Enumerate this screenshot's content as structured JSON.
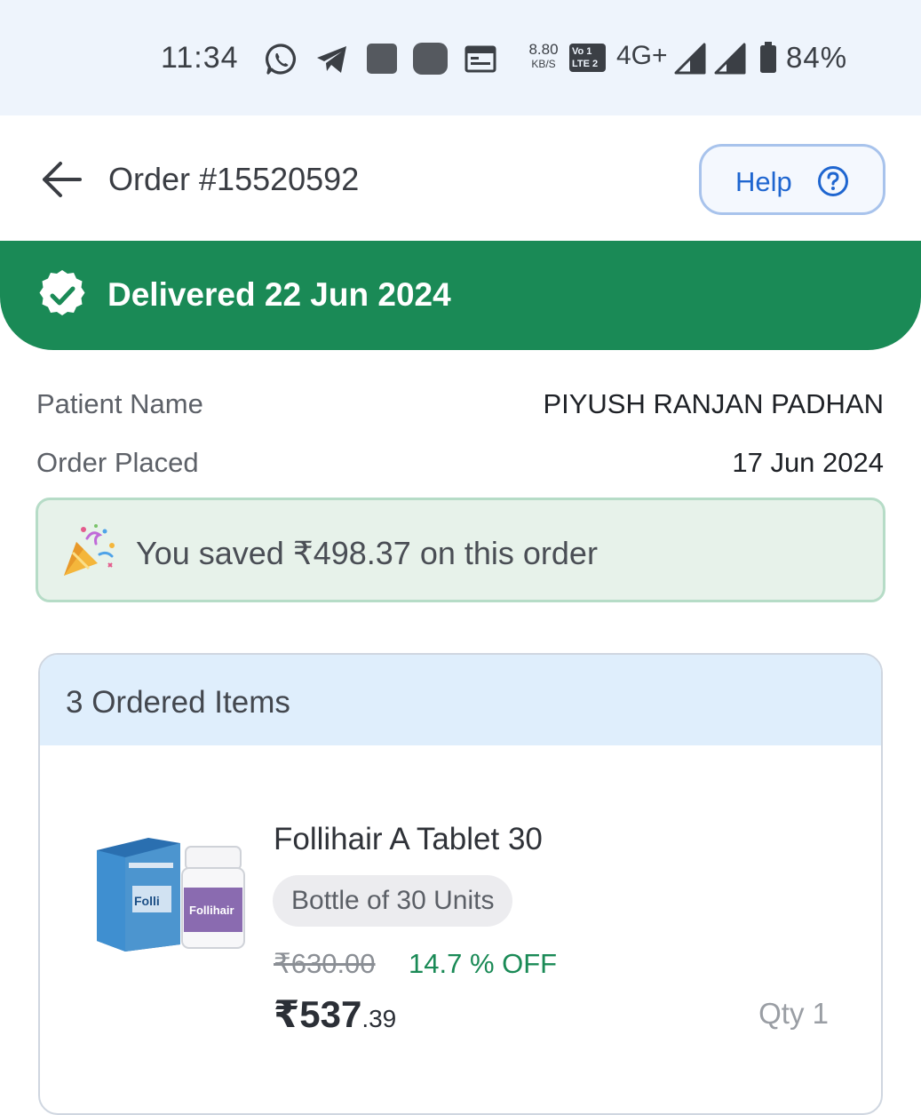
{
  "status_bar": {
    "time": "11:34",
    "net_speed_value": "8.80",
    "net_speed_unit": "KB/S",
    "volte_top": "Vo 1",
    "volte_bottom": "LTE 2",
    "network": "4G+",
    "battery": "84%",
    "icons": [
      "whatsapp-icon",
      "telegram-icon",
      "app-square-icon",
      "app-rounded-icon",
      "calendar-icon",
      "signal-sim1-icon",
      "signal-sim2-icon",
      "battery-icon"
    ]
  },
  "header": {
    "back_icon": "arrow-left-icon",
    "order_title": "Order #15520592",
    "help_label": "Help",
    "help_icon": "question-circle-icon"
  },
  "status_banner": {
    "icon": "check-badge-icon",
    "text": "Delivered 22 Jun 2024",
    "color": "#1a8a56"
  },
  "details": {
    "patient_label": "Patient Name",
    "patient_value": "PIYUSH RANJAN PADHAN",
    "placed_label": "Order Placed",
    "placed_value": "17 Jun 2024"
  },
  "savings": {
    "icon": "party-popper-icon",
    "text": "You saved ₹498.37 on this order"
  },
  "items_card": {
    "title": "3 Ordered Items",
    "items": [
      {
        "name": "Follihair A Tablet 30",
        "pack": "Bottle of 30 Units",
        "mrp": "₹630.00",
        "discount": "14.7 % OFF",
        "price_main": "₹537",
        "price_decimal": ".39",
        "qty": "Qty 1",
        "image": "follihair-product-image"
      }
    ]
  },
  "colors": {
    "accent_blue": "#1f66d0",
    "success_green": "#1a8a56",
    "status_bar_bg": "#eef4fc"
  }
}
